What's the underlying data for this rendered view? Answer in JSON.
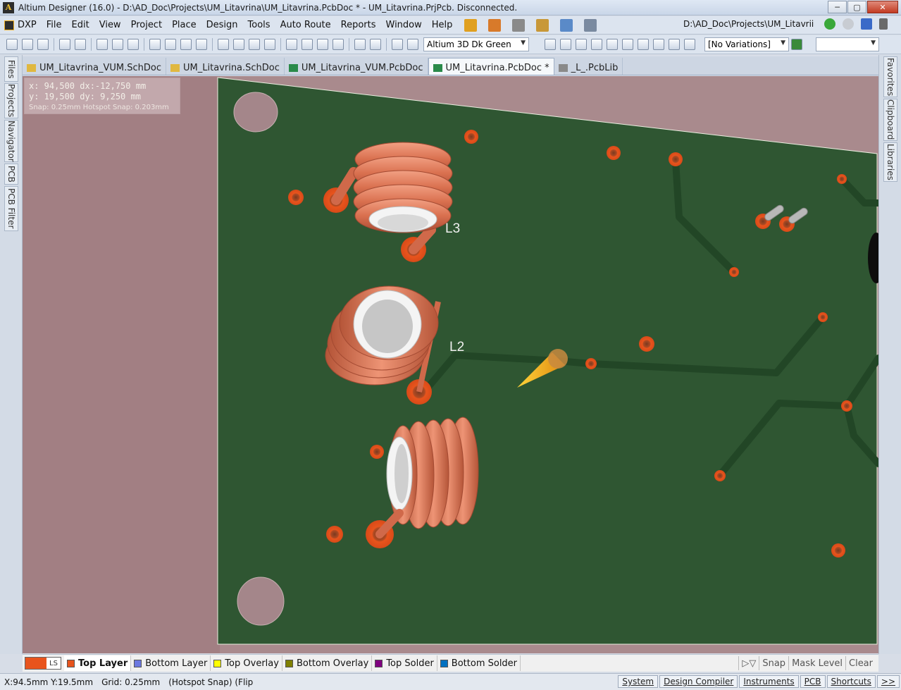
{
  "window": {
    "title": "Altium Designer (16.0) - D:\\AD_Doc\\Projects\\UM_Litavrina\\UM_Litavrina.PcbDoc * - UM_Litavrina.PrjPcb. Disconnected.",
    "minimize": "─",
    "maximize": "▢",
    "close": "✕"
  },
  "menu": {
    "items": [
      "DXP",
      "File",
      "Edit",
      "View",
      "Project",
      "Place",
      "Design",
      "Tools",
      "Auto Route",
      "Reports",
      "Window",
      "Help"
    ],
    "path": "D:\\AD_Doc\\Projects\\UM_Litavrii"
  },
  "toolbar": {
    "view_config": "Altium 3D Dk Green",
    "variations": "[No Variations]"
  },
  "tabs": [
    {
      "label": "UM_Litavrina_VUM.SchDoc",
      "icon": "schdoc-icon",
      "active": false
    },
    {
      "label": "UM_Litavrina.SchDoc",
      "icon": "schdoc-icon",
      "active": false
    },
    {
      "label": "UM_Litavrina_VUM.PcbDoc",
      "icon": "pcbdoc-icon",
      "active": false
    },
    {
      "label": "UM_Litavrina.PcbDoc *",
      "icon": "pcbdoc-icon",
      "active": true
    },
    {
      "label": "_L_.PcbLib",
      "icon": "pcblib-icon",
      "active": false
    }
  ],
  "left_panels": [
    "Files",
    "Projects",
    "Navigator",
    "PCB",
    "PCB Filter"
  ],
  "right_panels": [
    "Favorites",
    "Clipboard",
    "Libraries"
  ],
  "coords": {
    "line1": "x: 94,500   dx:-12,750 mm",
    "line2": "y: 19,500   dy:  9,250  mm",
    "snap": "Snap: 0.25mm Hotspot Snap: 0.203mm"
  },
  "designators": [
    "L3",
    "L2"
  ],
  "layers": {
    "ls_label": "LS",
    "items": [
      {
        "name": "Top Layer",
        "color": "#e8541d",
        "active": true
      },
      {
        "name": "Bottom Layer",
        "color": "#6c78e0",
        "active": false
      },
      {
        "name": "Top Overlay",
        "color": "#ffff00",
        "active": false
      },
      {
        "name": "Bottom Overlay",
        "color": "#808000",
        "active": false
      },
      {
        "name": "Top Solder",
        "color": "#800080",
        "active": false
      },
      {
        "name": "Bottom Solder",
        "color": "#0070c0",
        "active": false
      }
    ],
    "right": [
      "Snap",
      "Mask Level",
      "Clear"
    ]
  },
  "status": {
    "xy": "X:94.5mm Y:19.5mm",
    "grid": "Grid: 0.25mm",
    "snap": "(Hotspot Snap) (Flip",
    "buttons": [
      "System",
      "Design Compiler",
      "Instruments",
      "PCB",
      "Shortcuts",
      ">>"
    ]
  }
}
